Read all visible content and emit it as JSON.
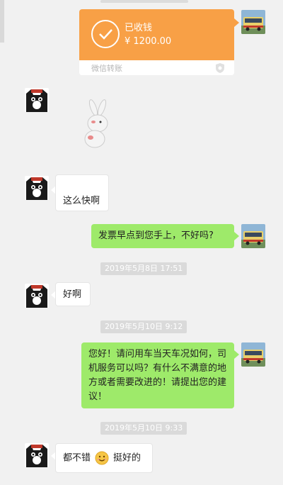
{
  "transfer": {
    "status": "已收钱",
    "amount": "¥ 1200.00",
    "source": "微信转账",
    "accent": "#f8a046"
  },
  "messages": {
    "m1": "这么快啊",
    "m2": "发票早点到您手上，不好吗?",
    "m3": "好啊",
    "m4": "您好！请问用车当天车况如何，司机服务可以吗？有什么不满意的地方或者需要改进的！请提出您的建议！",
    "m5_before": "都不错",
    "m5_after": "挺好的"
  },
  "timestamps": {
    "t1": "2019年5月8日 17:51",
    "t2": "2019年5月10日 9:12",
    "t3": "2019年5月10日 9:33"
  },
  "colors": {
    "bubble_right": "#9eea6a",
    "bubble_left": "#ffffff",
    "background": "#f1f1f1"
  }
}
